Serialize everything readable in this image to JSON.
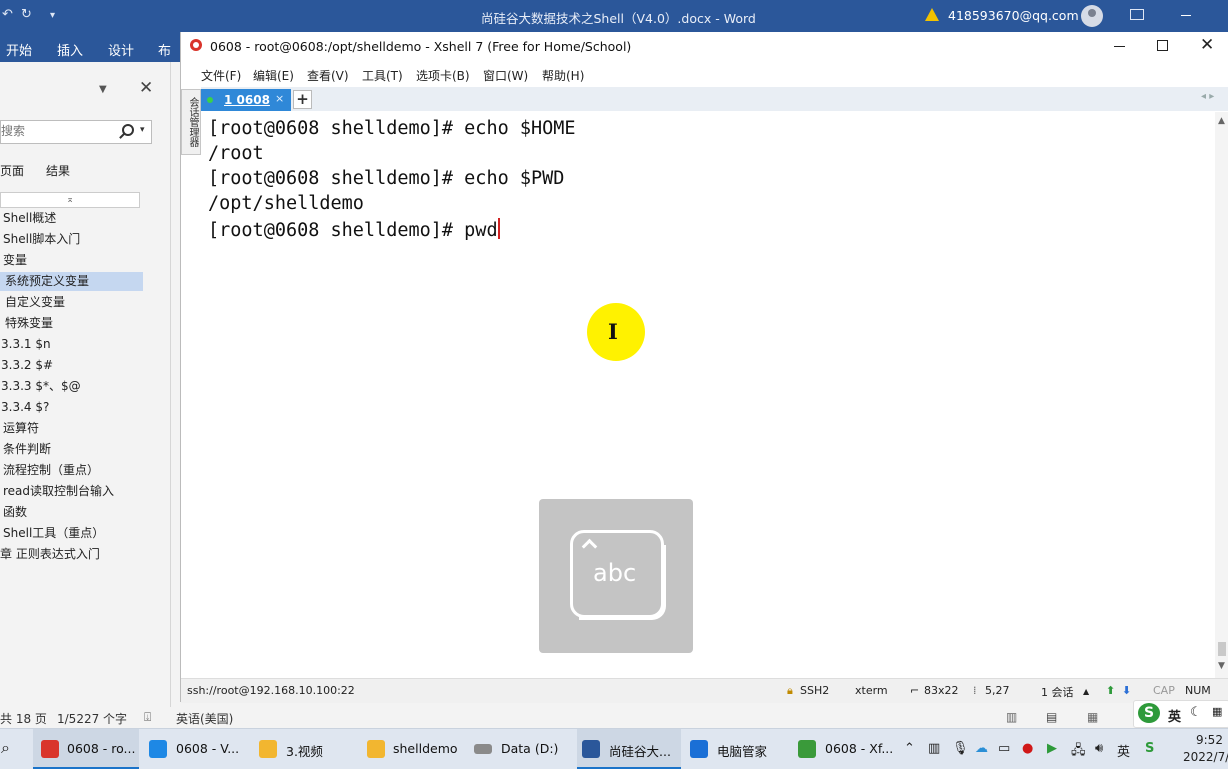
{
  "word": {
    "doc_title": "尚硅谷大数据技术之Shell（V4.0）.docx  -  Word",
    "user_email": "418593670@qq.com",
    "tabs": [
      "开始",
      "插入",
      "设计",
      "布局"
    ],
    "nav": {
      "search_placeholder": "搜索",
      "tab_pages": "页面",
      "tab_results": "结果",
      "collapse_glyph": "⌅",
      "items": [
        {
          "label": "Shell概述",
          "selected": false
        },
        {
          "label": "Shell脚本入门",
          "selected": false
        },
        {
          "label": "变量",
          "selected": false
        },
        {
          "label": "系统预定义变量",
          "selected": true
        },
        {
          "label": "自定义变量",
          "selected": false
        },
        {
          "label": "特殊变量",
          "selected": false
        },
        {
          "label": "3.3.1 $n",
          "selected": false
        },
        {
          "label": "3.3.2 $#",
          "selected": false
        },
        {
          "label": "3.3.3 $*、$@",
          "selected": false
        },
        {
          "label": "3.3.4 $?",
          "selected": false
        },
        {
          "label": "运算符",
          "selected": false
        },
        {
          "label": "条件判断",
          "selected": false
        },
        {
          "label": "流程控制（重点）",
          "selected": false
        },
        {
          "label": "read读取控制台输入",
          "selected": false
        },
        {
          "label": "函数",
          "selected": false
        },
        {
          "label": "Shell工具（重点）",
          "selected": false
        },
        {
          "label": "章 正则表达式入门",
          "selected": false
        }
      ]
    },
    "status": {
      "page": "共 18 页",
      "words": "1/5227 个字",
      "lang": "英语(美国)"
    }
  },
  "xshell": {
    "title": "0608 - root@0608:/opt/shelldemo - Xshell 7 (Free for Home/School)",
    "menu": [
      "文件(F)",
      "编辑(E)",
      "查看(V)",
      "工具(T)",
      "选项卡(B)",
      "窗口(W)",
      "帮助(H)"
    ],
    "sidebar_label": "会话管理器",
    "tab_label": "1 0608",
    "tab_close": "×",
    "tab_add": "+",
    "terminal": {
      "lines": [
        "[root@0608 shelldemo]# echo $HOME",
        "/root",
        "[root@0608 shelldemo]# echo $PWD",
        "/opt/shelldemo",
        "[root@0608 shelldemo]# pwd"
      ]
    },
    "cursor_glyph": "I",
    "ime_label": "abc",
    "status": {
      "connection": "ssh://root@192.168.10.100:22",
      "protocol": "SSH2",
      "term": "xterm",
      "size": "83x22",
      "pos": "5,27",
      "sessions": "1 会话",
      "cap": "CAP",
      "num": "NUM"
    }
  },
  "taskbar": {
    "items": [
      {
        "label": "0608 - ro...",
        "color": "#d9342b",
        "active": true
      },
      {
        "label": "0608 - V...",
        "color": "#1e88e5",
        "active": false
      },
      {
        "label": "3.视频",
        "color": "#f2b630",
        "active": false
      },
      {
        "label": "shelldemo",
        "color": "#f2b630",
        "active": false
      },
      {
        "label": "Data (D:)",
        "color": "#8a8a8a",
        "active": false
      },
      {
        "label": "尚硅谷大...",
        "color": "#2b579a",
        "active": true
      },
      {
        "label": "电脑管家",
        "color": "#1a6fd6",
        "active": false
      },
      {
        "label": "0608 - Xf...",
        "color": "#3a9a3a",
        "active": false
      }
    ],
    "ime_lang": "英",
    "time": "9:52",
    "date": "2022/7/"
  }
}
